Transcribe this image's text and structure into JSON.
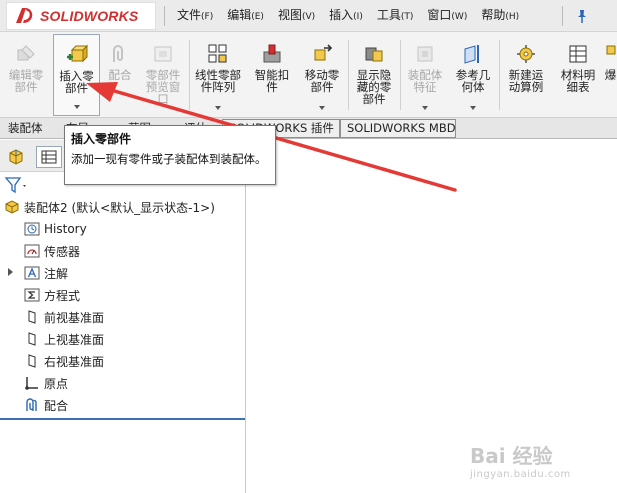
{
  "app": {
    "logo_text": "SOLIDWORKS",
    "brand_color": "#d32f2f"
  },
  "menu": [
    {
      "label": "文件",
      "key": "(F)"
    },
    {
      "label": "编辑",
      "key": "(E)"
    },
    {
      "label": "视图",
      "key": "(V)"
    },
    {
      "label": "插入",
      "key": "(I)"
    },
    {
      "label": "工具",
      "key": "(T)"
    },
    {
      "label": "窗口",
      "key": "(W)"
    },
    {
      "label": "帮助",
      "key": "(H)"
    }
  ],
  "ribbon": [
    {
      "label": "编辑零\n部件",
      "enabled": false,
      "icon": "edit-component-icon"
    },
    {
      "label": "插入零\n部件",
      "enabled": true,
      "icon": "insert-component-icon",
      "active": true
    },
    {
      "label": "配合",
      "enabled": false,
      "icon": "mate-icon"
    },
    {
      "label": "零部件\n预览窗\n口",
      "enabled": false,
      "icon": "component-preview-icon"
    },
    {
      "label": "线性零部\n件阵列",
      "enabled": true,
      "icon": "linear-pattern-icon"
    },
    {
      "label": "智能扣\n件",
      "enabled": true,
      "icon": "smart-fasteners-icon"
    },
    {
      "label": "移动零\n部件",
      "enabled": true,
      "icon": "move-component-icon"
    },
    {
      "label": "显示隐\n藏的零\n部件",
      "enabled": true,
      "icon": "show-hidden-icon"
    },
    {
      "label": "装配体\n特征",
      "enabled": false,
      "icon": "assembly-feature-icon"
    },
    {
      "label": "参考几\n何体",
      "enabled": true,
      "icon": "reference-geometry-icon"
    },
    {
      "label": "新建运\n动算例",
      "enabled": true,
      "icon": "motion-study-icon"
    },
    {
      "label": "材料明\n细表",
      "enabled": true,
      "icon": "bom-icon"
    },
    {
      "label": "爆",
      "enabled": true,
      "icon": "exploded-view-icon"
    }
  ],
  "tabs": [
    "装配体",
    "布局",
    "草图",
    "评估",
    "SOLIDWORKS 插件",
    "SOLIDWORKS MBD"
  ],
  "tooltip": {
    "title": "插入零部件",
    "body": "添加一现有零件或子装配体到装配体。"
  },
  "tree": {
    "root": "装配体2  (默认<默认_显示状态-1>)",
    "items": [
      {
        "label": "History",
        "icon": "history-icon"
      },
      {
        "label": "传感器",
        "icon": "sensor-icon"
      },
      {
        "label": "注解",
        "icon": "annotation-icon",
        "expandable": true
      },
      {
        "label": "方程式",
        "icon": "equation-icon"
      },
      {
        "label": "前视基准面",
        "icon": "plane-icon"
      },
      {
        "label": "上视基准面",
        "icon": "plane-icon"
      },
      {
        "label": "右视基准面",
        "icon": "plane-icon"
      },
      {
        "label": "原点",
        "icon": "origin-icon"
      },
      {
        "label": "配合",
        "icon": "mates-folder-icon"
      }
    ]
  },
  "annotation": {
    "arrow_color": "#e53935"
  },
  "watermark": {
    "text": "Bai 经验",
    "sub": "jingyan.baidu.com"
  }
}
